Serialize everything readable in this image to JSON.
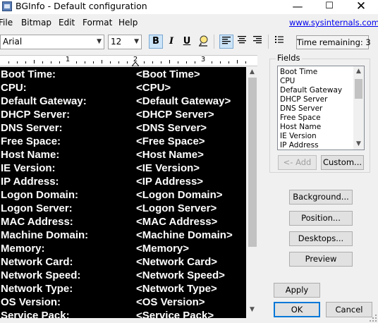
{
  "window": {
    "title": "BGInfo - Default configuration",
    "min_glyph": "—",
    "max_glyph": "☐",
    "close_glyph": "✕"
  },
  "menu": [
    "File",
    "Bitmap",
    "Edit",
    "Format",
    "Help"
  ],
  "link": "www.sysinternals.com",
  "toolbar": {
    "font_name": "Arial",
    "font_size": "12",
    "bold": "B",
    "italic": "I",
    "underline": "U",
    "time_remaining": "Time remaining: 3"
  },
  "ruler_numbers": [
    "1",
    "2",
    "3"
  ],
  "editor_rows": [
    {
      "key": "Boot Time:",
      "value": "<Boot Time>"
    },
    {
      "key": "CPU:",
      "value": "<CPU>"
    },
    {
      "key": "Default Gateway:",
      "value": "<Default Gateway>"
    },
    {
      "key": "DHCP Server:",
      "value": "<DHCP Server>"
    },
    {
      "key": "DNS Server:",
      "value": "<DNS Server>"
    },
    {
      "key": "Free Space:",
      "value": "<Free Space>"
    },
    {
      "key": "Host Name:",
      "value": "<Host Name>"
    },
    {
      "key": "IE Version:",
      "value": "<IE Version>"
    },
    {
      "key": "IP Address:",
      "value": "<IP Address>"
    },
    {
      "key": "Logon Domain:",
      "value": "<Logon Domain>"
    },
    {
      "key": "Logon Server:",
      "value": "<Logon Server>"
    },
    {
      "key": "MAC Address:",
      "value": "<MAC Address>"
    },
    {
      "key": "Machine Domain:",
      "value": "<Machine Domain>"
    },
    {
      "key": "Memory:",
      "value": "<Memory>"
    },
    {
      "key": "Network Card:",
      "value": "<Network Card>"
    },
    {
      "key": "Network Speed:",
      "value": "<Network Speed>"
    },
    {
      "key": "Network Type:",
      "value": "<Network Type>"
    },
    {
      "key": "OS Version:",
      "value": "<OS Version>"
    },
    {
      "key": "Service Pack:",
      "value": "<Service Pack>"
    }
  ],
  "fields": {
    "title": "Fields",
    "items": [
      "Boot Time",
      "CPU",
      "Default Gateway",
      "DHCP Server",
      "DNS Server",
      "Free Space",
      "Host Name",
      "IE Version",
      "IP Address"
    ],
    "add_label": "<- Add",
    "custom_label": "Custom..."
  },
  "buttons": {
    "background": "Background...",
    "position": "Position...",
    "desktops": "Desktops...",
    "preview": "Preview",
    "apply": "Apply",
    "ok": "OK",
    "cancel": "Cancel"
  },
  "colors": {
    "editor_bg": "#000000",
    "editor_text": "#ffffff",
    "link": "#0000ee",
    "default_button_border": "#0078d7"
  }
}
